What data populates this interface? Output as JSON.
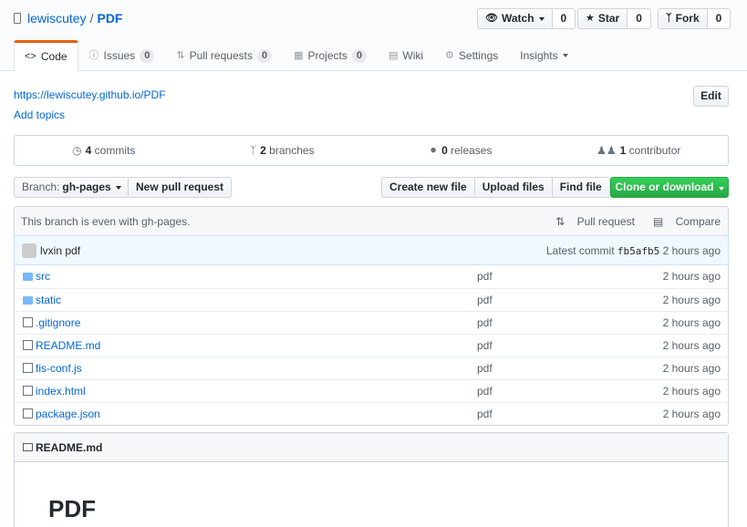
{
  "repo": {
    "owner": "lewiscutey",
    "separator": "/",
    "name": "PDF"
  },
  "actions": [
    {
      "label": "Watch",
      "count": "0",
      "icon": "eye-icon"
    },
    {
      "label": "Star",
      "count": "0",
      "icon": "star-icon"
    },
    {
      "label": "Fork",
      "count": "0",
      "icon": "fork-icon"
    }
  ],
  "tabs": [
    {
      "label": "Code",
      "icon": "code-icon",
      "selected": true
    },
    {
      "label": "Issues",
      "count": "0",
      "icon": "issue-icon"
    },
    {
      "label": "Pull requests",
      "count": "0",
      "icon": "pr-icon"
    },
    {
      "label": "Projects",
      "count": "0",
      "icon": "project-icon"
    },
    {
      "label": "Wiki",
      "icon": "wiki-icon"
    },
    {
      "label": "Settings",
      "icon": "gear-icon"
    },
    {
      "label": "Insights",
      "icon": "caret-down-icon"
    }
  ],
  "homepage": "https://lewiscutey.github.io/PDF",
  "add_topics": "Add topics",
  "edit_label": "Edit",
  "summary": [
    {
      "count": "4",
      "label": "commits",
      "icon": "history-icon"
    },
    {
      "count": "2",
      "label": "branches",
      "icon": "branch-icon"
    },
    {
      "count": "0",
      "label": "releases",
      "icon": "tag-icon"
    },
    {
      "count": "1",
      "label": "contributor",
      "icon": "people-icon"
    }
  ],
  "branch": {
    "prefix": "Branch:",
    "name": "gh-pages"
  },
  "new_pr_label": "New pull request",
  "file_buttons": [
    "Create new file",
    "Upload files",
    "Find file"
  ],
  "clone_label": "Clone or download",
  "branch_info": {
    "message": "This branch is even with gh-pages.",
    "pull_request": "Pull request",
    "compare": "Compare"
  },
  "commit": {
    "author": "lvxin",
    "message": "pdf",
    "latest_label": "Latest commit",
    "sha": "fb5afb5",
    "age": "2 hours ago"
  },
  "files": [
    {
      "name": "src",
      "type": "folder",
      "message": "pdf",
      "age": "2 hours ago"
    },
    {
      "name": "static",
      "type": "folder",
      "message": "pdf",
      "age": "2 hours ago"
    },
    {
      "name": ".gitignore",
      "type": "file",
      "message": "pdf",
      "age": "2 hours ago"
    },
    {
      "name": "README.md",
      "type": "file",
      "message": "pdf",
      "age": "2 hours ago"
    },
    {
      "name": "fis-conf.js",
      "type": "file",
      "message": "pdf",
      "age": "2 hours ago"
    },
    {
      "name": "index.html",
      "type": "file",
      "message": "pdf",
      "age": "2 hours ago"
    },
    {
      "name": "package.json",
      "type": "file",
      "message": "pdf",
      "age": "2 hours ago"
    }
  ],
  "readme": {
    "title": "README.md",
    "heading": "PDF"
  },
  "colors": {
    "link": "#0366d6",
    "tab_accent": "#e36209",
    "clone_green": "#28a745"
  }
}
